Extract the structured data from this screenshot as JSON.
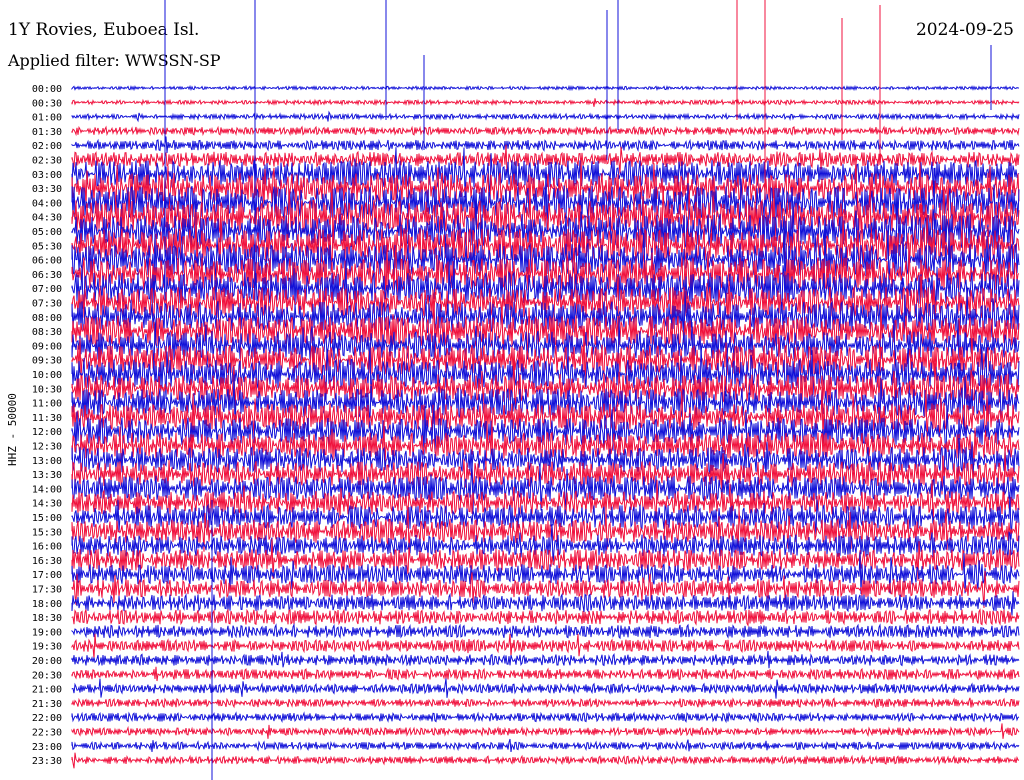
{
  "header": {
    "title": "1Y Rovies, Euboea Isl.",
    "filter": "Applied filter: WWSSN-SP",
    "date": "2024-09-25"
  },
  "chart_data": {
    "type": "line",
    "ylabel": "HHZ - 50000",
    "colors": [
      "#1010d8",
      "#f0103c"
    ],
    "row_labels": [
      "00:00",
      "00:30",
      "01:00",
      "01:30",
      "02:00",
      "02:30",
      "03:00",
      "03:30",
      "04:00",
      "04:30",
      "05:00",
      "05:30",
      "06:00",
      "06:30",
      "07:00",
      "07:30",
      "08:00",
      "08:30",
      "09:00",
      "09:30",
      "10:00",
      "10:30",
      "11:00",
      "11:30",
      "12:00",
      "12:30",
      "13:00",
      "13:30",
      "14:00",
      "14:30",
      "15:00",
      "15:30",
      "16:00",
      "16:30",
      "17:00",
      "17:30",
      "18:00",
      "18:30",
      "19:00",
      "19:30",
      "20:00",
      "20:30",
      "21:00",
      "21:30",
      "22:00",
      "22:30",
      "23:00",
      "23:30"
    ],
    "activity_level": [
      0.05,
      0.1,
      0.15,
      0.3,
      0.45,
      0.7,
      1.4,
      1.6,
      1.7,
      1.7,
      1.8,
      1.8,
      1.7,
      1.7,
      1.6,
      1.6,
      1.6,
      1.6,
      1.5,
      1.5,
      1.5,
      1.5,
      1.5,
      1.4,
      1.4,
      1.3,
      1.3,
      1.3,
      1.3,
      1.2,
      1.2,
      1.2,
      1.1,
      1.1,
      1.0,
      0.9,
      0.8,
      0.7,
      0.6,
      0.55,
      0.5,
      0.45,
      0.4,
      0.35,
      0.35,
      0.3,
      0.3,
      0.3
    ]
  }
}
